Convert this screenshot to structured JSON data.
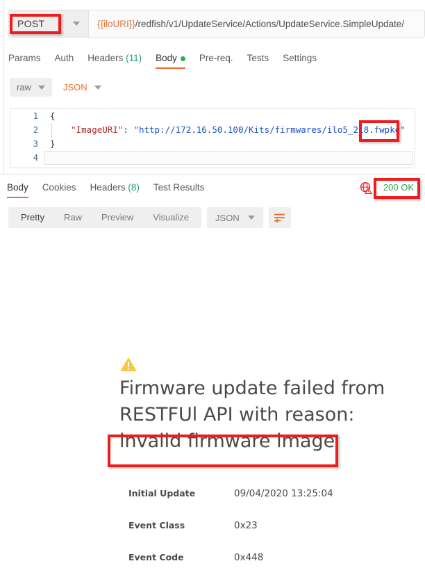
{
  "request": {
    "method": "POST",
    "url_prefix": "{{iloURI}}",
    "url_rest": "/redfish/v1/UpdateService/Actions/UpdateService.SimpleUpdate/",
    "tabs": [
      {
        "label": "Params",
        "active": false
      },
      {
        "label": "Auth",
        "active": false
      },
      {
        "label": "Headers",
        "count": "(11)",
        "active": false
      },
      {
        "label": "Body",
        "active": true,
        "dot": true
      },
      {
        "label": "Pre-req.",
        "active": false
      },
      {
        "label": "Tests",
        "active": false
      },
      {
        "label": "Settings",
        "active": false
      }
    ],
    "body_mode": "raw",
    "body_language": "JSON",
    "code": {
      "line1_no": "1",
      "line1_text": "{",
      "line2_no": "2",
      "line2_key": "\"ImageURI\"",
      "line2_colon": ": ",
      "line2_value": "\"http://172.16.50.100/Kits/firmwares/ilo5_218.fwpkg\"",
      "line3_no": "3",
      "line3_text": "}",
      "line4_no": "4",
      "line4_text": ""
    }
  },
  "response": {
    "tabs": [
      {
        "label": "Body",
        "active": true
      },
      {
        "label": "Cookies",
        "active": false
      },
      {
        "label": "Headers",
        "count": "(8)",
        "active": false
      },
      {
        "label": "Test Results",
        "active": false
      }
    ],
    "status": "200 OK",
    "view_modes": [
      {
        "label": "Pretty",
        "active": true
      },
      {
        "label": "Raw",
        "active": false
      },
      {
        "label": "Preview",
        "active": false
      },
      {
        "label": "Visualize",
        "active": false
      }
    ],
    "format": "JSON",
    "preview": {
      "message_line1": "Firmware update failed from",
      "message_line2": "RESTFUl API with reason:",
      "message_line3": "invalid firmware image",
      "details": [
        {
          "label": "Initial Update",
          "value": "09/04/2020 13:25:04"
        },
        {
          "label": "Event Class",
          "value": "0x23"
        },
        {
          "label": "Event Code",
          "value": "0x448"
        }
      ]
    }
  },
  "annotations": {
    "method_box": "POST",
    "fwpkg_box": ".fwpkg",
    "status_box": "200 OK",
    "reason_box": "invalid firmware image"
  },
  "colors": {
    "accent_orange": "#ef6c2e",
    "annotation_red": "#ee1c1c",
    "status_green": "#2bab4a",
    "warning_yellow": "#f5ca44",
    "json_string_blue": "#1a4fc4",
    "json_key_maroon": "#a52a2a"
  }
}
